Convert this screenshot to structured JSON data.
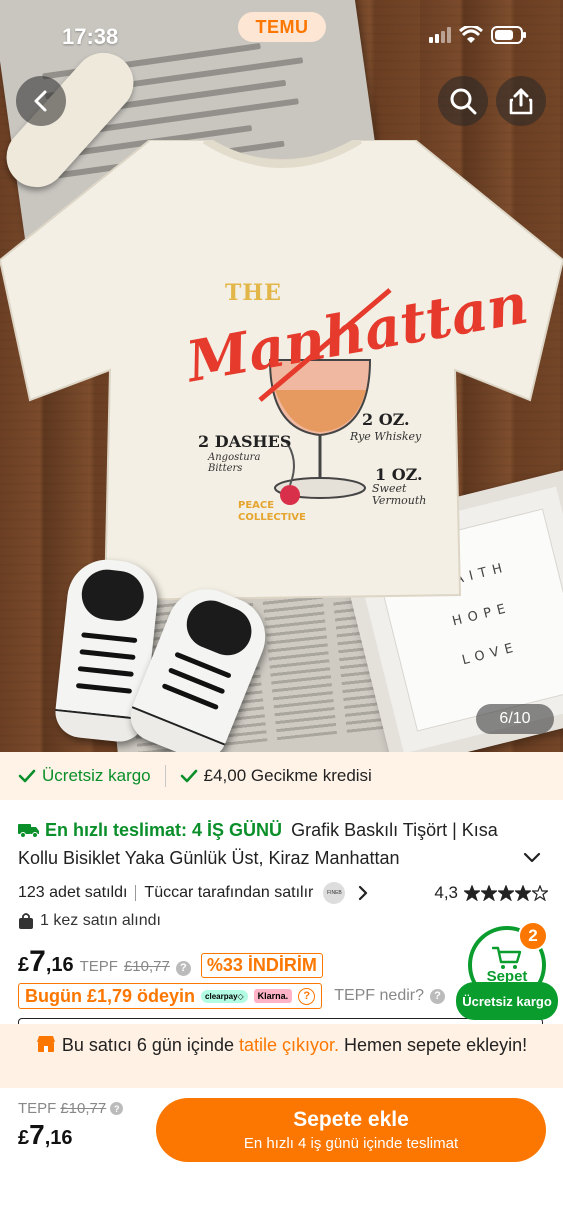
{
  "status_bar": {
    "time": "17:38",
    "brand": "TEMU"
  },
  "gallery": {
    "counter": "6/10"
  },
  "benefits": {
    "free_shipping": "Ücretsiz kargo",
    "delay_credit": "£4,00 Gecikme kredisi"
  },
  "product": {
    "fast_delivery": "En hızlı teslimat: 4 İŞ GÜNÜ",
    "title": "Grafik Baskılı Tişört | Kısa Kollu Bisiklet Yaka Günlük Üst, Kiraz Manhattan",
    "sold_count": "123 adet satıldı",
    "seller_text": "Tüccar tarafından satılır",
    "seller_logo_text": "FINEB",
    "rating": "4,3",
    "rating_value": 4.3,
    "bought_text": "1 kez satın alındı"
  },
  "price": {
    "currency": "£",
    "whole": "7",
    "decimal": ",16",
    "tepf": "TEPF",
    "old_price": "£10,77",
    "discount": "%33 İNDİRİM",
    "pay_today": "Bugün £1,79 ödeyin",
    "clearpay": "clearpay◇",
    "klarna": "Klarna.",
    "tepf_what": "TEPF nedir?"
  },
  "cart": {
    "label": "Sepet",
    "count": "2",
    "free_shipping": "Ücretsiz kargo"
  },
  "vacation": {
    "prefix": "Bu satıcı 6 gün içinde ",
    "highlight": "tatile çıkıyor.",
    "suffix": " Hemen sepete ekleyin!"
  },
  "bottom": {
    "tepf": "TEPF",
    "old_price": "£10,77",
    "currency": "£",
    "whole": "7",
    "decimal": ",16",
    "add_to_cart": "Sepete ekle",
    "delivery": "En hızlı 4 iş günü içinde teslimat"
  },
  "shirt_print": {
    "the": "THE",
    "name": "Manhattan",
    "dashes": "2 DASHES",
    "bitters": "Angostura Bitters",
    "rye_oz": "2 OZ.",
    "rye": "Rye Whiskey",
    "vermouth_oz": "1 OZ.",
    "vermouth": "Sweet Vermouth",
    "brand": "PEACE COLLECTIVE"
  },
  "frame_words": [
    "FAITH",
    "HOPE",
    "LOVE"
  ],
  "colors": {
    "accent": "#fb7701",
    "green": "#0a8f2a",
    "cart_green": "#0a9d2e"
  },
  "icons": [
    "back-icon",
    "search-icon",
    "share-icon",
    "check-icon",
    "truck-icon",
    "chevron-down-icon",
    "chevron-right-icon",
    "star-icon",
    "bag-icon",
    "info-icon",
    "help-icon",
    "cart-icon",
    "shop-icon"
  ]
}
